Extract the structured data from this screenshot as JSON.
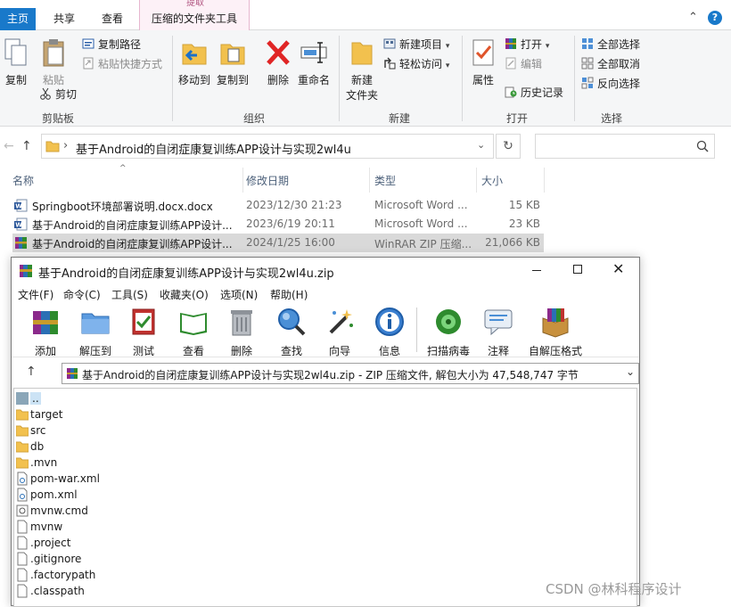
{
  "explorer": {
    "tabs": [
      "主页",
      "共享",
      "查看",
      "压缩的文件夹工具"
    ],
    "context_group_title": "提取",
    "ribbon": {
      "clipboard": {
        "label": "剪贴板",
        "copy": "复制",
        "paste": "粘贴",
        "copy_path": "复制路径",
        "paste_shortcut": "粘贴快捷方式",
        "cut": "剪切"
      },
      "organize": {
        "label": "组织",
        "move_to": "移动到",
        "copy_to": "复制到",
        "delete": "删除",
        "rename": "重命名"
      },
      "new": {
        "label": "新建",
        "new_folder": "新建\n文件夹",
        "new_folder_line1": "新建",
        "new_folder_line2": "文件夹",
        "new_item": "新建项目",
        "easy_access": "轻松访问"
      },
      "open": {
        "label": "打开",
        "properties": "属性",
        "open": "打开",
        "edit": "编辑",
        "history": "历史记录"
      },
      "select": {
        "label": "选择",
        "select_all": "全部选择",
        "select_none": "全部取消",
        "invert": "反向选择"
      }
    },
    "address": {
      "path": "基于Android的自闭症康复训练APP设计与实现2wl4u",
      "separator": "›"
    },
    "columns": {
      "name": "名称",
      "date": "修改日期",
      "type": "类型",
      "size": "大小"
    },
    "files": [
      {
        "name": "Springboot环境部署说明.docx.docx",
        "date": "2023/12/30 21:23",
        "type": "Microsoft Word ...",
        "size": "15 KB",
        "icon": "word"
      },
      {
        "name": "基于Android的自闭症康复训练APP设计...",
        "date": "2023/6/19 20:11",
        "type": "Microsoft Word ...",
        "size": "23 KB",
        "icon": "word"
      },
      {
        "name": "基于Android的自闭症康复训练APP设计...",
        "date": "2024/1/25 16:00",
        "type": "WinRAR ZIP 压缩...",
        "size": "21,066 KB",
        "icon": "winrar"
      }
    ]
  },
  "winrar": {
    "title": "基于Android的自闭症康复训练APP设计与实现2wl4u.zip",
    "menu": [
      "文件(F)",
      "命令(C)",
      "工具(S)",
      "收藏夹(O)",
      "选项(N)",
      "帮助(H)"
    ],
    "toolbar": [
      "添加",
      "解压到",
      "测试",
      "查看",
      "删除",
      "查找",
      "向导",
      "信息",
      "扫描病毒",
      "注释",
      "自解压格式"
    ],
    "path_text": "基于Android的自闭症康复训练APP设计与实现2wl4u.zip - ZIP 压缩文件, 解包大小为 47,548,747 字节",
    "entries": [
      {
        "name": "..",
        "icon": "parent"
      },
      {
        "name": "target",
        "icon": "folder"
      },
      {
        "name": "src",
        "icon": "folder"
      },
      {
        "name": "db",
        "icon": "folder"
      },
      {
        "name": ".mvn",
        "icon": "folder"
      },
      {
        "name": "pom-war.xml",
        "icon": "xml"
      },
      {
        "name": "pom.xml",
        "icon": "xml"
      },
      {
        "name": "mvnw.cmd",
        "icon": "cmd"
      },
      {
        "name": "mvnw",
        "icon": "file"
      },
      {
        "name": ".project",
        "icon": "file"
      },
      {
        "name": ".gitignore",
        "icon": "file"
      },
      {
        "name": ".factorypath",
        "icon": "file"
      },
      {
        "name": ".classpath",
        "icon": "file"
      }
    ]
  },
  "watermark": "CSDN @林科程序设计"
}
